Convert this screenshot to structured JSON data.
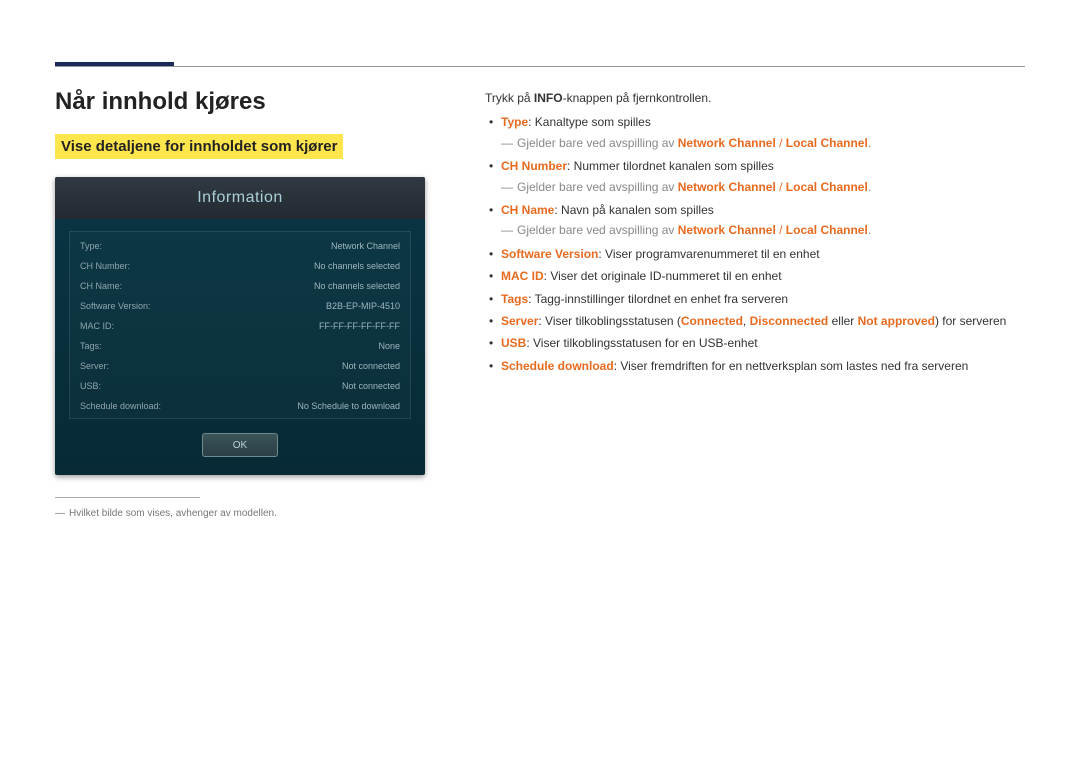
{
  "heading": "Når innhold kjøres",
  "subheading": "Vise detaljene for innholdet som kjører",
  "screenshot": {
    "title": "Information",
    "rows": [
      {
        "label": "Type:",
        "value": "Network Channel"
      },
      {
        "label": "CH Number:",
        "value": "No channels selected"
      },
      {
        "label": "CH Name:",
        "value": "No channels selected"
      },
      {
        "label": "Software Version:",
        "value": "B2B-EP-MIP-4510"
      },
      {
        "label": "MAC ID:",
        "value": "FF-FF-FF-FF-FF-FF"
      },
      {
        "label": "Tags:",
        "value": "None"
      },
      {
        "label": "Server:",
        "value": "Not connected"
      },
      {
        "label": "USB:",
        "value": "Not connected"
      },
      {
        "label": "Schedule download:",
        "value": "No Schedule to download"
      }
    ],
    "ok_label": "OK"
  },
  "footnote": "Hvilket bilde som vises, avhenger av modellen.",
  "intro_pre": "Trykk på ",
  "intro_bold": "INFO",
  "intro_post": "-knappen på fjernkontrollen.",
  "bullets": {
    "type_label": "Type",
    "type_text": ": Kanaltype som spilles",
    "applies_pre": "Gjelder bare ved avspilling av ",
    "nc": "Network Channel",
    "sep": " / ",
    "lc": "Local Channel",
    "period": ".",
    "chnum_label": "CH Number",
    "chnum_text": ": Nummer tilordnet kanalen som spilles",
    "chname_label": "CH Name",
    "chname_text": ": Navn på kanalen som spilles",
    "sw_label": "Software Version",
    "sw_text": ": Viser programvarenummeret til en enhet",
    "mac_label": "MAC ID",
    "mac_text": ": Viser det originale ID-nummeret til en enhet",
    "tags_label": "Tags",
    "tags_text": ": Tagg-innstillinger tilordnet en enhet fra serveren",
    "server_label": "Server",
    "server_pre": ": Viser tilkoblingsstatusen (",
    "server_connected": "Connected",
    "server_comma": ", ",
    "server_disconnected": "Disconnected",
    "server_or": " eller ",
    "server_notapproved": "Not approved",
    "server_post": ") for serveren",
    "usb_label": "USB",
    "usb_text": ": Viser tilkoblingsstatusen for en USB-enhet",
    "sched_label": "Schedule download",
    "sched_text": ": Viser fremdriften for en nettverksplan som lastes ned fra serveren"
  }
}
